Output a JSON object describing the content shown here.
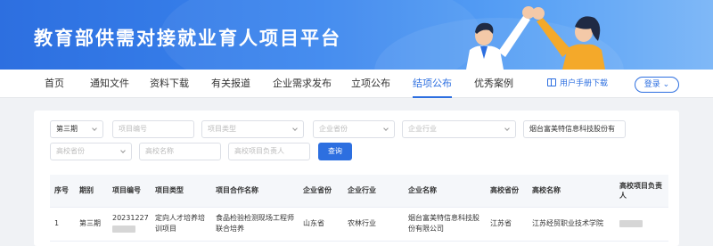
{
  "header": {
    "title": "教育部供需对接就业育人项目平台"
  },
  "nav": {
    "items": [
      "首页",
      "通知文件",
      "资料下载",
      "有关报道",
      "企业需求发布",
      "立项公布",
      "结项公布",
      "优秀案例"
    ],
    "active_index": 6,
    "manual_label": "用户手册下载",
    "login_label": "登录"
  },
  "filters": {
    "period": "第三期",
    "project_no": "项目编号",
    "project_type": "项目类型",
    "company_province": "企业省份",
    "company_industry": "企业行业",
    "company_name": "烟台富美特信息科技股份有",
    "school_province": "高校省份",
    "school_name": "高校名称",
    "school_owner": "高校项目负责人",
    "query_label": "查询"
  },
  "table": {
    "columns": [
      "序号",
      "期别",
      "项目编号",
      "项目类型",
      "项目合作名称",
      "企业省份",
      "企业行业",
      "企业名称",
      "高校省份",
      "高校名称",
      "高校项目负责人"
    ],
    "rows": [
      [
        "1",
        "第三期",
        "20231227",
        "定向人才培养培训项目",
        "食品检验检测现场工程师联合培养",
        "山东省",
        "农林行业",
        "烟台富美特信息科技股份有限公司",
        "江苏省",
        "江苏经贸职业技术学院",
        ""
      ]
    ]
  },
  "colors": {
    "accent": "#2d6fe0",
    "banner_start": "#2d6fe0",
    "banner_end": "#7fb8f7"
  }
}
